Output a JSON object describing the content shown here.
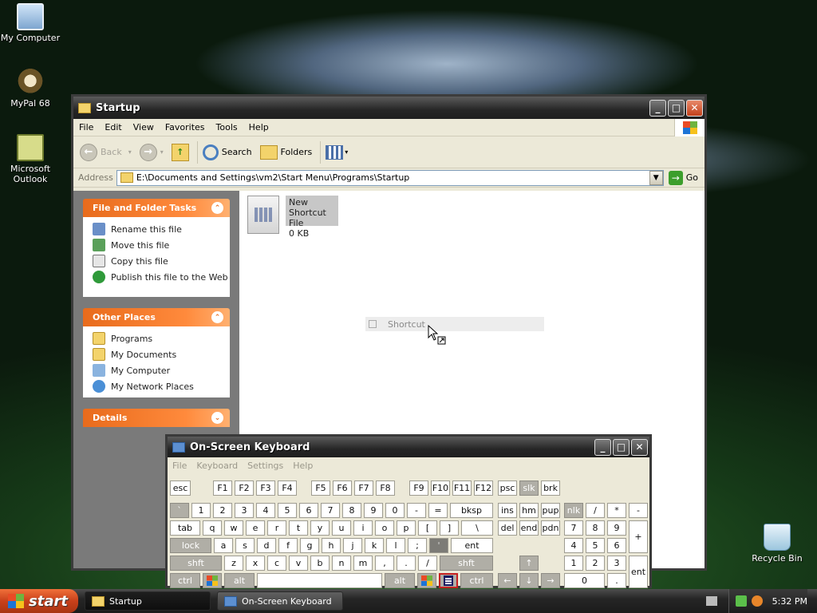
{
  "desktop": {
    "icons": [
      {
        "label": "My Computer"
      },
      {
        "label": "MyPal 68"
      },
      {
        "label": "Microsoft Outlook"
      },
      {
        "label": "Recycle Bin"
      }
    ]
  },
  "explorer": {
    "title": "Startup",
    "menu": [
      "File",
      "Edit",
      "View",
      "Favorites",
      "Tools",
      "Help"
    ],
    "toolbar": {
      "back": "Back",
      "search": "Search",
      "folders": "Folders"
    },
    "address": {
      "label": "Address",
      "value": "E:\\Documents and Settings\\vm2\\Start Menu\\Programs\\Startup",
      "go": "Go"
    },
    "panels": {
      "file_tasks": {
        "title": "File and Folder Tasks",
        "items": [
          "Rename this file",
          "Move this file",
          "Copy this file",
          "Publish this file to the Web"
        ]
      },
      "other_places": {
        "title": "Other Places",
        "items": [
          "Programs",
          "My Documents",
          "My Computer",
          "My Network Places"
        ]
      },
      "details": {
        "title": "Details"
      }
    },
    "file": {
      "name": "New Shortcut",
      "type": "File",
      "size": "0 KB"
    },
    "drag_label": "Shortcut"
  },
  "osk": {
    "title": "On-Screen Keyboard",
    "menu": [
      "File",
      "Keyboard",
      "Settings",
      "Help"
    ],
    "keys": {
      "esc": "esc",
      "f1": "F1",
      "f2": "F2",
      "f3": "F3",
      "f4": "F4",
      "f5": "F5",
      "f6": "F6",
      "f7": "F7",
      "f8": "F8",
      "f9": "F9",
      "f10": "F10",
      "f11": "F11",
      "f12": "F12",
      "psc": "psc",
      "slk": "slk",
      "brk": "brk",
      "grave": "`",
      "n1": "1",
      "n2": "2",
      "n3": "3",
      "n4": "4",
      "n5": "5",
      "n6": "6",
      "n7": "7",
      "n8": "8",
      "n9": "9",
      "n0": "0",
      "minus": "-",
      "equals": "=",
      "bksp": "bksp",
      "ins": "ins",
      "hm": "hm",
      "pup": "pup",
      "nlk": "nlk",
      "kslash": "/",
      "kstar": "*",
      "kminus": "-",
      "tab": "tab",
      "q": "q",
      "w": "w",
      "e": "e",
      "r": "r",
      "t": "t",
      "y": "y",
      "u": "u",
      "i": "i",
      "o": "o",
      "p": "p",
      "lbr": "[",
      "rbr": "]",
      "bslash": "\\",
      "del": "del",
      "end": "end",
      "pdn": "pdn",
      "k7": "7",
      "k8": "8",
      "k9": "9",
      "kplus": "+",
      "lock": "lock",
      "a": "a",
      "s": "s",
      "d": "d",
      "f": "f",
      "g": "g",
      "h": "h",
      "j": "j",
      "k": "k",
      "l": "l",
      "semi": ";",
      "quote": "'",
      "ent": "ent",
      "k4": "4",
      "k5": "5",
      "k6": "6",
      "shft": "shft",
      "z": "z",
      "x": "x",
      "c": "c",
      "v": "v",
      "b": "b",
      "n": "n",
      "m": "m",
      "comma": ",",
      "period": ".",
      "slash": "/",
      "rshft": "shft",
      "up": "↑",
      "k1": "1",
      "k2": "2",
      "k3": "3",
      "kent": "ent",
      "ctrl": "ctrl",
      "alt": "alt",
      "altgr": "alt",
      "rctrl": "ctrl",
      "left": "←",
      "down": "↓",
      "right": "→",
      "k0": "0",
      "kdot": "."
    }
  },
  "taskbar": {
    "start": "start",
    "buttons": [
      {
        "label": "Startup"
      },
      {
        "label": "On-Screen Keyboard"
      }
    ],
    "clock": "5:32 PM"
  }
}
